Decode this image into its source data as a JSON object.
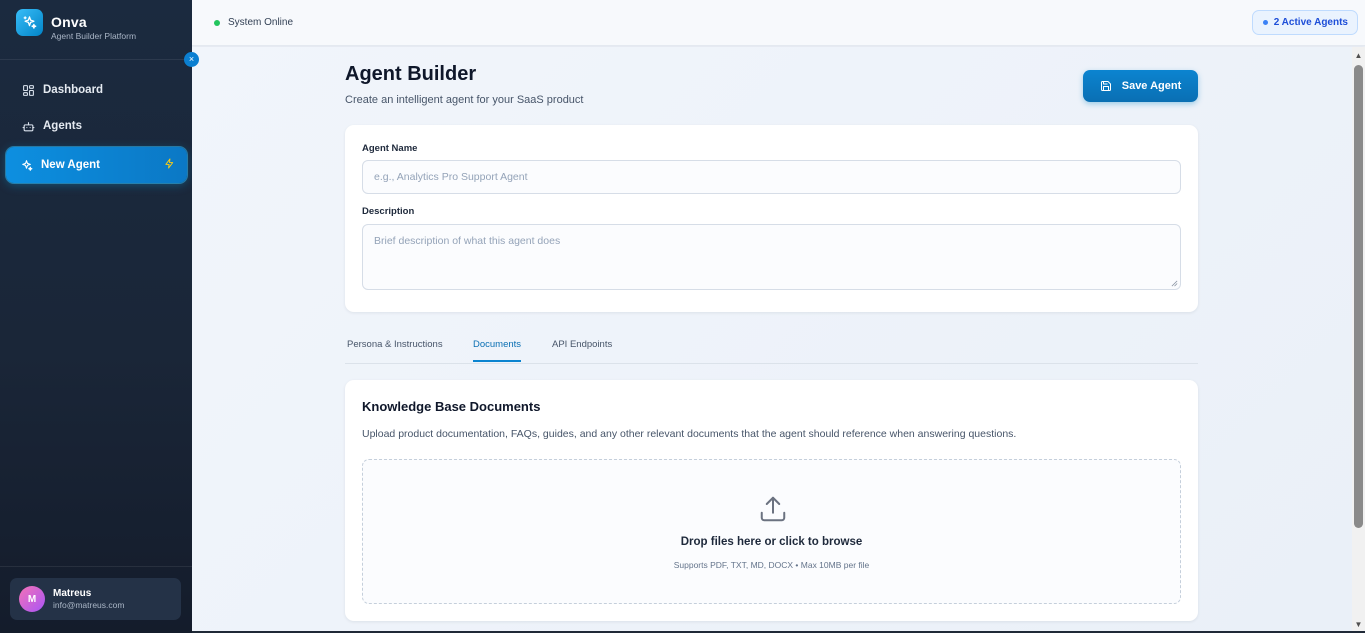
{
  "brand": {
    "name": "Onva",
    "subtitle": "Agent Builder Platform"
  },
  "sidebar": {
    "items": [
      {
        "label": "Dashboard",
        "icon": "grid-icon"
      },
      {
        "label": "Agents",
        "icon": "bot-icon"
      },
      {
        "label": "New Agent",
        "icon": "sparkles-icon",
        "badge_icon": "bolt-icon",
        "active": true
      }
    ]
  },
  "collapse_glyph": "×",
  "user": {
    "initial": "M",
    "name": "Matreus",
    "email": "info@matreus.com"
  },
  "topbar": {
    "status": "System Online",
    "active_agents": "2 Active Agents"
  },
  "page": {
    "title": "Agent Builder",
    "subtitle": "Create an intelligent agent for your SaaS product",
    "save_label": "Save Agent"
  },
  "form": {
    "name_label": "Agent Name",
    "name_placeholder": "e.g., Analytics Pro Support Agent",
    "desc_label": "Description",
    "desc_placeholder": "Brief description of what this agent does"
  },
  "tabs": [
    {
      "label": "Persona & Instructions"
    },
    {
      "label": "Documents",
      "active": true
    },
    {
      "label": "API Endpoints"
    }
  ],
  "documents": {
    "title": "Knowledge Base Documents",
    "description": "Upload product documentation, FAQs, guides, and any other relevant documents that the agent should reference when answering questions.",
    "drop_title": "Drop files here or click to browse",
    "drop_sub": "Supports PDF, TXT, MD, DOCX • Max 10MB per file"
  },
  "colors": {
    "accent": "#0b84d0",
    "sidebar_bg": "#1b2a3f",
    "status_green": "#22c55e"
  }
}
